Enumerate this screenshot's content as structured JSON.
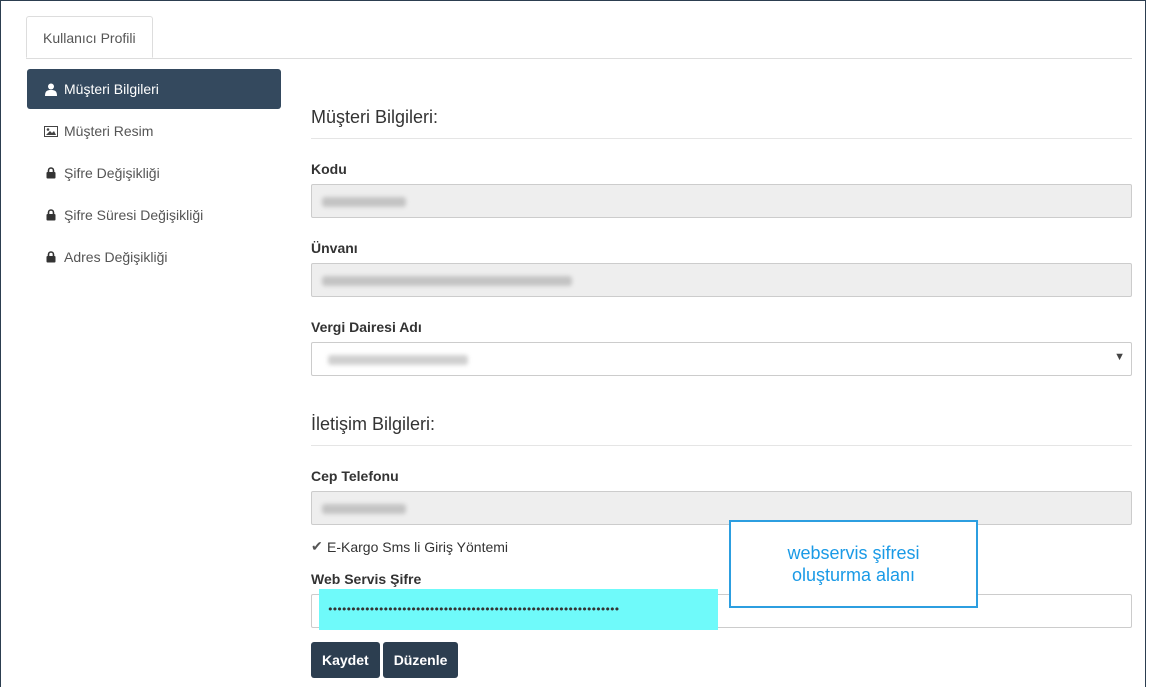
{
  "tab": {
    "label": "Kullanıcı Profili"
  },
  "sidebar": {
    "items": [
      {
        "label": "Müşteri Bilgileri",
        "icon": "user-icon",
        "active": true
      },
      {
        "label": "Müşteri Resim",
        "icon": "image-icon",
        "active": false
      },
      {
        "label": "Şifre Değişikliği",
        "icon": "lock-icon",
        "active": false
      },
      {
        "label": "Şifre Süresi Değişikliği",
        "icon": "lock-icon",
        "active": false
      },
      {
        "label": "Adres Değişikliği",
        "icon": "lock-icon",
        "active": false
      }
    ]
  },
  "customer": {
    "section_title": "Müşteri Bilgileri:",
    "kodu_label": "Kodu",
    "unvan_label": "Ünvanı",
    "vergi_label": "Vergi Dairesi Adı"
  },
  "contact": {
    "section_title": "İletişim Bilgileri:",
    "phone_label": "Cep Telefonu",
    "sms_label": "E-Kargo Sms li Giriş Yöntemi",
    "sms_checked": true,
    "webservice_label": "Web Servis Şifre",
    "webservice_value": "•••••••••••••••••••••••••••••••••••••••••••••••••••••••••••••••"
  },
  "buttons": {
    "save": "Kaydet",
    "edit": "Düzenle"
  },
  "callout": {
    "line1": "webservis şifresi",
    "line2": "oluşturma alanı"
  },
  "colors": {
    "primary": "#34495e",
    "highlight": "#6ffafa",
    "callout": "#1a9ae6"
  }
}
